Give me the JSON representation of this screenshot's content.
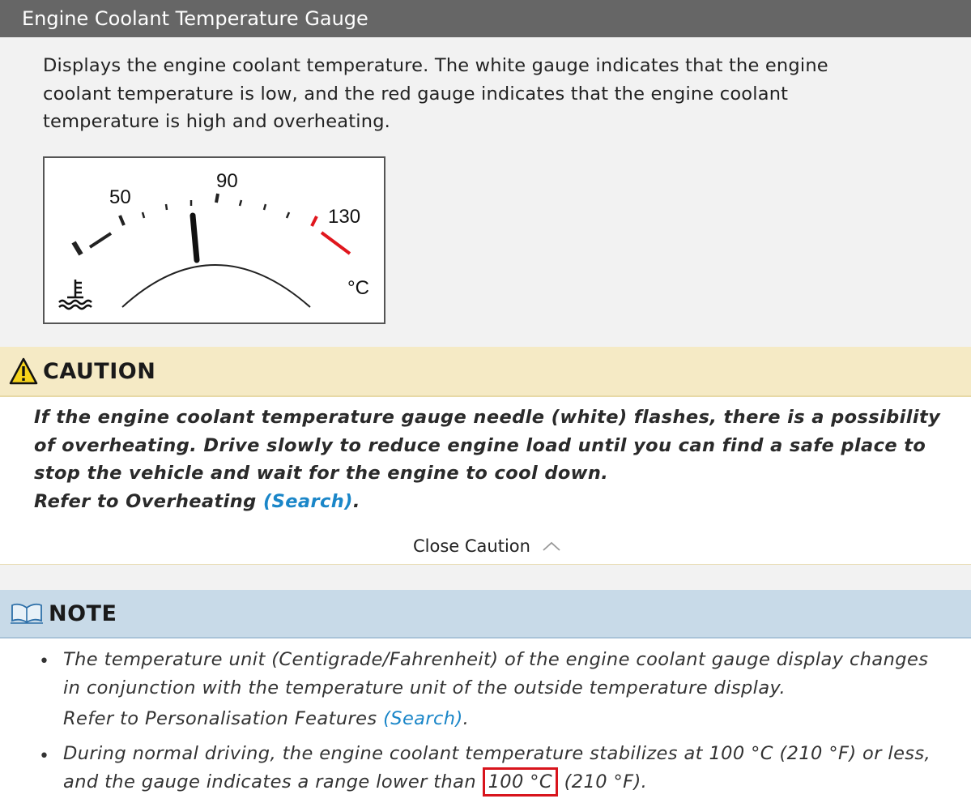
{
  "header": {
    "title": "Engine Coolant Temperature Gauge"
  },
  "intro": {
    "text": "Displays the engine coolant temperature. The white gauge indicates that the engine coolant temperature is low, and the red gauge indicates that the engine coolant temperature is high and overheating."
  },
  "gauge": {
    "labels": {
      "low": "50",
      "mid": "90",
      "high": "130",
      "unit": "°C"
    },
    "red_color": "#e0161d",
    "needle_value": 90
  },
  "caution": {
    "title": "CAUTION",
    "text": "If the engine coolant temperature gauge needle (white) flashes, there is a possibility of overheating. Drive slowly to reduce engine load until you can find a safe place to stop the vehicle and wait for the engine to cool down.",
    "refer_prefix": "Refer to Overheating ",
    "refer_link": "(Search)",
    "refer_suffix": ".",
    "close_label": "Close Caution"
  },
  "note": {
    "title": "NOTE",
    "items": [
      {
        "text": "The temperature unit (Centigrade/Fahrenheit) of the engine coolant gauge display changes in conjunction with the temperature unit of the outside temperature display.",
        "refer_prefix": "Refer to Personalisation Features ",
        "refer_link": "(Search)",
        "refer_suffix": "."
      },
      {
        "text_before": "During normal driving, the engine coolant temperature stabilizes at 100 °C (210 °F) or less, and the gauge indicates a range lower than ",
        "highlight": "100 °C",
        "text_after": " (210 °F)."
      }
    ]
  },
  "colors": {
    "header_bg": "#666666",
    "caution_bg": "#f5eac5",
    "note_bg": "#c8dae8",
    "link": "#1a86c8",
    "highlight_border": "#d8141c"
  }
}
